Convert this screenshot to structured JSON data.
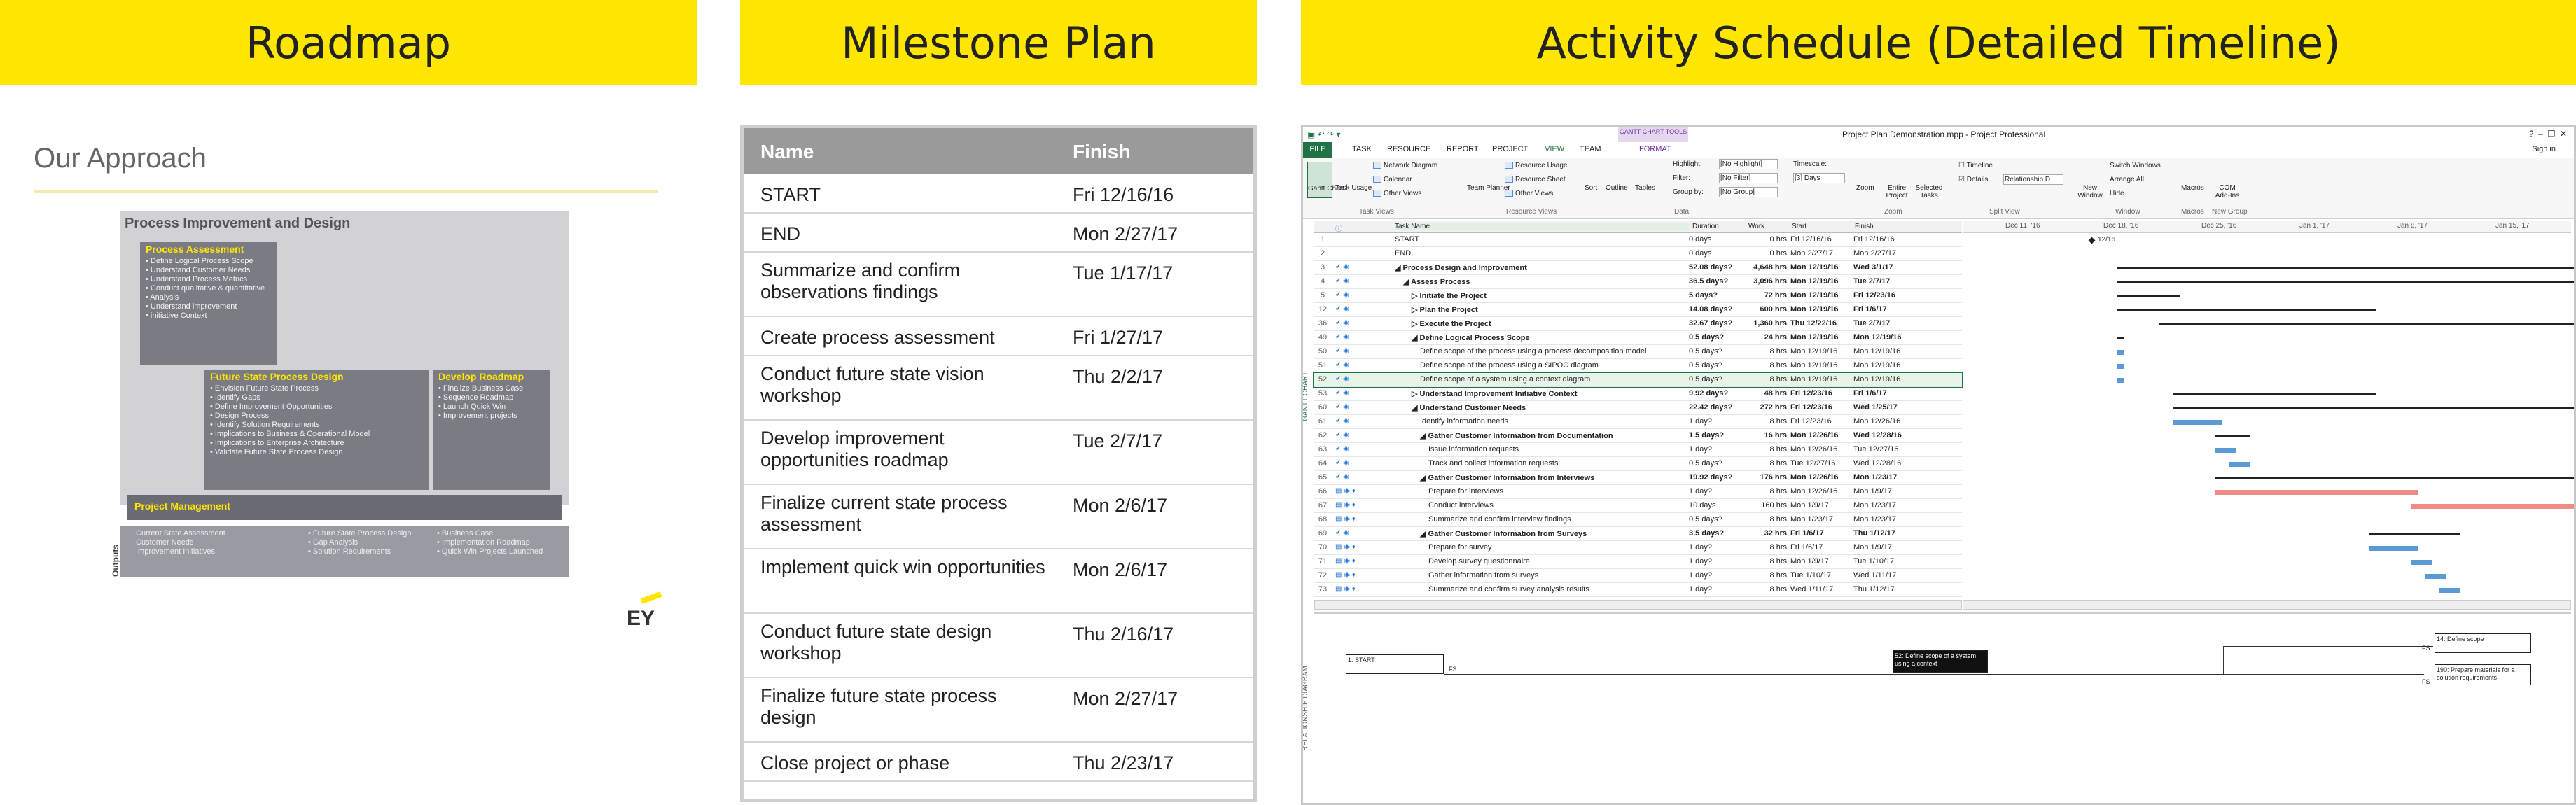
{
  "banners": {
    "roadmap": "Roadmap",
    "milestone": "Milestone Plan",
    "activity": "Activity Schedule (Detailed Timeline)"
  },
  "roadmap": {
    "heading": "Our Approach",
    "outer_title": "Process Improvement and Design",
    "assessment": {
      "title": "Process Assessment",
      "items": [
        "Define Logical Process Scope",
        "Understand Customer Needs",
        "Understand Process Metrics",
        "Conduct qualitative & quantitative",
        "Analysis",
        "Understand improvement",
        "initiative Context"
      ]
    },
    "future": {
      "title": "Future State Process Design",
      "items": [
        "Envision Future State Process",
        "Identify Gaps",
        "Define Improvement Opportunities",
        "Design Process",
        "Identify Solution Requirements",
        "Implications to Business & Operational Model",
        "Implications to Enterprise Architecture",
        "Validate Future State Process Design"
      ]
    },
    "develop": {
      "title": "Develop Roadmap",
      "items": [
        "Finalize Business Case",
        "Sequence Roadmap",
        "Launch Quick Win",
        "Improvement projects"
      ]
    },
    "pm": "Project Management",
    "outputs_label": "Outputs",
    "outputs": [
      [
        "Current State Assessment",
        "Customer Needs",
        "Improvement Initiatives"
      ],
      [
        "Future State Process Design",
        "Gap Analysis",
        "Solution Requirements"
      ],
      [
        "Business Case",
        "Implementation Roadmap",
        "Quick Win Projects Launched"
      ]
    ],
    "logo": "EY"
  },
  "milestones": {
    "headers": [
      "Name",
      "Finish"
    ],
    "rows": [
      [
        "START",
        "Fri 12/16/16"
      ],
      [
        "END",
        "Mon 2/27/17"
      ],
      [
        "Summarize and confirm observations findings",
        "Tue 1/17/17"
      ],
      [
        "Create process assessment",
        "Fri 1/27/17"
      ],
      [
        "Conduct future state vision workshop",
        "Thu 2/2/17"
      ],
      [
        "Develop improvement opportunities roadmap",
        "Tue 2/7/17"
      ],
      [
        "Finalize current state process assessment",
        "Mon 2/6/17"
      ],
      [
        "Implement quick win opportunities",
        "Mon 2/6/17"
      ],
      [
        "Conduct future state design workshop",
        "Thu 2/16/17"
      ],
      [
        "Finalize future state process design",
        "Mon 2/27/17"
      ],
      [
        "Close project or phase",
        "Thu 2/23/17"
      ]
    ]
  },
  "project": {
    "window_title": "Project Plan Demonstration.mpp - Project Professional",
    "signin": "Sign in",
    "gantt_tools": "GANTT CHART TOOLS",
    "tabs": [
      "FILE",
      "TASK",
      "RESOURCE",
      "REPORT",
      "PROJECT",
      "VIEW",
      "TEAM",
      "FORMAT"
    ],
    "ribbon": {
      "gantt_chart": "Gantt Chart",
      "task_usage": "Task Usage",
      "network": "Network Diagram",
      "calendar": "Calendar",
      "other_views": "Other Views",
      "team_planner": "Team Planner",
      "resource_usage": "Resource Usage",
      "resource_sheet": "Resource Sheet",
      "other_views2": "Other Views",
      "sort": "Sort",
      "outline": "Outline",
      "tables": "Tables",
      "highlight": "Highlight:",
      "highlight_val": "[No Highlight]",
      "filter": "Filter:",
      "filter_val": "[No Filter]",
      "groupby": "Group by:",
      "groupby_val": "[No Group]",
      "timescale": "Timescale:",
      "timescale_val": "[3] Days",
      "zoom": "Zoom",
      "entire": "Entire Project",
      "selected": "Selected Tasks",
      "timeline": "Timeline",
      "details": "Details",
      "details_val": "Relationship D",
      "new_window": "New Window",
      "switch": "Switch Windows",
      "arrange": "Arrange All",
      "hide": "Hide",
      "macros": "Macros",
      "com": "COM Add-Ins",
      "groups": [
        "Task Views",
        "Resource Views",
        "Data",
        "Zoom",
        "Split View",
        "Window",
        "Macros",
        "New Group"
      ]
    },
    "grid_headers": [
      "Task Name",
      "Duration",
      "Work",
      "Start",
      "Finish"
    ],
    "rows": [
      {
        "n": "1",
        "name": "START",
        "dur": "0 days",
        "work": "0 hrs",
        "start": "Fri 12/16/16",
        "finish": "Fri 12/16/16",
        "lvl": 0,
        "b": false
      },
      {
        "n": "2",
        "name": "END",
        "dur": "0 days",
        "work": "0 hrs",
        "start": "Mon 2/27/17",
        "finish": "Mon 2/27/17",
        "lvl": 0,
        "b": false
      },
      {
        "n": "3",
        "name": "◢ Process Design and Improvement",
        "dur": "52.08 days?",
        "work": "4,648 hrs",
        "start": "Mon 12/19/16",
        "finish": "Wed 3/1/17",
        "lvl": 0,
        "b": true
      },
      {
        "n": "4",
        "name": "◢ Assess Process",
        "dur": "36.5 days?",
        "work": "3,096 hrs",
        "start": "Mon 12/19/16",
        "finish": "Tue 2/7/17",
        "lvl": 1,
        "b": true
      },
      {
        "n": "5",
        "name": "▷ Initiate the Project",
        "dur": "5 days?",
        "work": "72 hrs",
        "start": "Mon 12/19/16",
        "finish": "Fri 12/23/16",
        "lvl": 2,
        "b": true
      },
      {
        "n": "12",
        "name": "▷ Plan the Project",
        "dur": "14.08 days?",
        "work": "600 hrs",
        "start": "Mon 12/19/16",
        "finish": "Fri 1/6/17",
        "lvl": 2,
        "b": true
      },
      {
        "n": "36",
        "name": "▷ Execute the Project",
        "dur": "32.67 days?",
        "work": "1,360 hrs",
        "start": "Thu 12/22/16",
        "finish": "Tue 2/7/17",
        "lvl": 2,
        "b": true
      },
      {
        "n": "49",
        "name": "◢ Define Logical Process Scope",
        "dur": "0.5 days?",
        "work": "24 hrs",
        "start": "Mon 12/19/16",
        "finish": "Mon 12/19/16",
        "lvl": 2,
        "b": true
      },
      {
        "n": "50",
        "name": "Define scope of the process using a process decomposition model",
        "dur": "0.5 days?",
        "work": "8 hrs",
        "start": "Mon 12/19/16",
        "finish": "Mon 12/19/16",
        "lvl": 3,
        "b": false
      },
      {
        "n": "51",
        "name": "Define scope of the process using a SIPOC diagram",
        "dur": "0.5 days?",
        "work": "8 hrs",
        "start": "Mon 12/19/16",
        "finish": "Mon 12/19/16",
        "lvl": 3,
        "b": false
      },
      {
        "n": "52",
        "name": "Define scope of a system using a context diagram",
        "dur": "0.5 days?",
        "work": "8 hrs",
        "start": "Mon 12/19/16",
        "finish": "Mon 12/19/16",
        "lvl": 3,
        "b": false
      },
      {
        "n": "53",
        "name": "▷ Understand Improvement Initiative Context",
        "dur": "9.92 days?",
        "work": "48 hrs",
        "start": "Fri 12/23/16",
        "finish": "Fri 1/6/17",
        "lvl": 2,
        "b": true
      },
      {
        "n": "60",
        "name": "◢ Understand Customer Needs",
        "dur": "22.42 days?",
        "work": "272 hrs",
        "start": "Fri 12/23/16",
        "finish": "Wed 1/25/17",
        "lvl": 2,
        "b": true
      },
      {
        "n": "61",
        "name": "Identify information needs",
        "dur": "1 day?",
        "work": "8 hrs",
        "start": "Fri 12/23/16",
        "finish": "Mon 12/26/16",
        "lvl": 3,
        "b": false
      },
      {
        "n": "62",
        "name": "◢ Gather Customer Information from Documentation",
        "dur": "1.5 days?",
        "work": "16 hrs",
        "start": "Mon 12/26/16",
        "finish": "Wed 12/28/16",
        "lvl": 3,
        "b": true
      },
      {
        "n": "63",
        "name": "Issue information requests",
        "dur": "1 day?",
        "work": "8 hrs",
        "start": "Mon 12/26/16",
        "finish": "Tue 12/27/16",
        "lvl": 4,
        "b": false
      },
      {
        "n": "64",
        "name": "Track and collect information requests",
        "dur": "0.5 days?",
        "work": "8 hrs",
        "start": "Tue 12/27/16",
        "finish": "Wed 12/28/16",
        "lvl": 4,
        "b": false
      },
      {
        "n": "65",
        "name": "◢ Gather Customer Information from Interviews",
        "dur": "19.92 days?",
        "work": "176 hrs",
        "start": "Mon 12/26/16",
        "finish": "Mon 1/23/17",
        "lvl": 3,
        "b": true
      },
      {
        "n": "66",
        "name": "Prepare for interviews",
        "dur": "1 day?",
        "work": "8 hrs",
        "start": "Mon 12/26/16",
        "finish": "Mon 1/9/17",
        "lvl": 4,
        "b": false
      },
      {
        "n": "67",
        "name": "Conduct interviews",
        "dur": "10 days",
        "work": "160 hrs",
        "start": "Mon 1/9/17",
        "finish": "Mon 1/23/17",
        "lvl": 4,
        "b": false
      },
      {
        "n": "68",
        "name": "Summarize and confirm interview findings",
        "dur": "0.5 days?",
        "work": "8 hrs",
        "start": "Mon 1/23/17",
        "finish": "Mon 1/23/17",
        "lvl": 4,
        "b": false
      },
      {
        "n": "69",
        "name": "◢ Gather Customer Information from Surveys",
        "dur": "3.5 days?",
        "work": "32 hrs",
        "start": "Fri 1/6/17",
        "finish": "Thu 1/12/17",
        "lvl": 3,
        "b": true
      },
      {
        "n": "70",
        "name": "Prepare for survey",
        "dur": "1 day?",
        "work": "8 hrs",
        "start": "Fri 1/6/17",
        "finish": "Mon 1/9/17",
        "lvl": 4,
        "b": false
      },
      {
        "n": "71",
        "name": "Develop survey questionnaire",
        "dur": "1 day?",
        "work": "8 hrs",
        "start": "Mon 1/9/17",
        "finish": "Tue 1/10/17",
        "lvl": 4,
        "b": false
      },
      {
        "n": "72",
        "name": "Gather information from surveys",
        "dur": "1 day?",
        "work": "8 hrs",
        "start": "Tue 1/10/17",
        "finish": "Wed 1/11/17",
        "lvl": 4,
        "b": false
      },
      {
        "n": "73",
        "name": "Summarize and confirm survey analysis results",
        "dur": "1 day?",
        "work": "8 hrs",
        "start": "Wed 1/11/17",
        "finish": "Thu 1/12/17",
        "lvl": 4,
        "b": false
      }
    ],
    "timeline_weeks": [
      "Dec 11, '16",
      "Dec 18, '16",
      "Dec 25, '16",
      "Jan 1, '17",
      "Jan 8, '17",
      "Jan 15, '17"
    ],
    "milestone_label": "12/16",
    "side_gantt": "GANTT CHART",
    "side_rel": "RELATIONSHIP DIAGRAM",
    "rel": {
      "start": "1: START",
      "sel": "52: Define scope of a system using a context",
      "r1": "14: Define scope",
      "r2": "190: Prepare materials for a solution requirements",
      "fs": "FS"
    }
  }
}
